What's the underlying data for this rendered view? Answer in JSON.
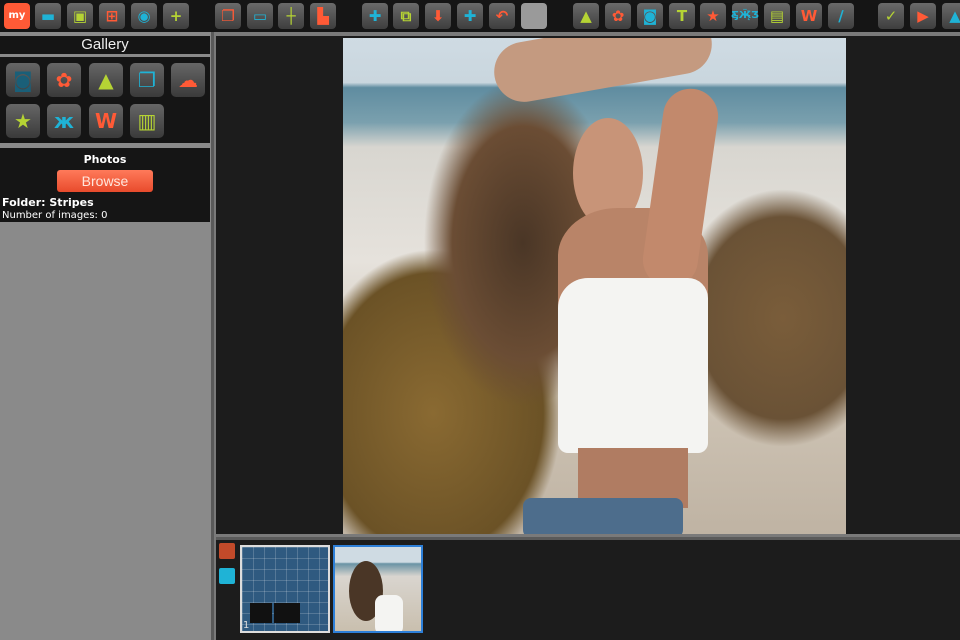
{
  "toolbar": {
    "items": [
      {
        "name": "my-logo",
        "glyph": "my",
        "color": "#ff5a36",
        "bg": "#ff5a36",
        "fg": "#fff"
      },
      {
        "name": "open-folder",
        "glyph": "▬",
        "color": "#1fb3d6"
      },
      {
        "name": "save",
        "glyph": "▣",
        "color": "#b5d334"
      },
      {
        "name": "layout-grid",
        "glyph": "⊞",
        "color": "#ff5a36"
      },
      {
        "name": "download-circle",
        "glyph": "◉",
        "color": "#1fb3d6"
      },
      {
        "name": "new-page",
        "glyph": "+",
        "color": "#b5d334"
      },
      {
        "name": "layers",
        "glyph": "❐",
        "color": "#ff5a36"
      },
      {
        "name": "frame",
        "glyph": "▭",
        "color": "#1fb3d6"
      },
      {
        "name": "crosshair",
        "glyph": "┼",
        "color": "#b5d334"
      },
      {
        "name": "puzzle",
        "glyph": "▙",
        "color": "#ff5a36"
      },
      {
        "name": "gift-box",
        "glyph": "✚",
        "color": "#1fb3d6"
      },
      {
        "name": "shuffle-photos",
        "glyph": "⧉",
        "color": "#b5d334"
      },
      {
        "name": "bag-down",
        "glyph": "⬇",
        "color": "#ff5a36"
      },
      {
        "name": "bag-plus",
        "glyph": "✚",
        "color": "#1fb3d6"
      },
      {
        "name": "undo",
        "glyph": "↶",
        "color": "#ff5a36"
      },
      {
        "name": "blank",
        "glyph": "",
        "color": "#999"
      },
      {
        "name": "image",
        "glyph": "▲",
        "color": "#b5d334"
      },
      {
        "name": "flower",
        "glyph": "✿",
        "color": "#ff5a36"
      },
      {
        "name": "camera",
        "glyph": "◙",
        "color": "#1fb3d6"
      },
      {
        "name": "text",
        "glyph": "T",
        "color": "#b5d334"
      },
      {
        "name": "star-badge",
        "glyph": "★",
        "color": "#ff5a36"
      },
      {
        "name": "butterfly",
        "glyph": "Ƹ̵̡Ӝ̵̨̄Ʒ",
        "color": "#1fb3d6"
      },
      {
        "name": "ticket",
        "glyph": "▤",
        "color": "#b5d334"
      },
      {
        "name": "word-art",
        "glyph": "W",
        "color": "#ff5a36"
      },
      {
        "name": "brush",
        "glyph": "∕",
        "color": "#1fb3d6"
      },
      {
        "name": "check",
        "glyph": "✓",
        "color": "#b5d334"
      },
      {
        "name": "play",
        "glyph": "▶",
        "color": "#ff5a36"
      },
      {
        "name": "share",
        "glyph": "▲",
        "color": "#1fb3d6"
      }
    ]
  },
  "gallery": {
    "title": "Gallery",
    "items": [
      {
        "name": "camera",
        "glyph": "◙",
        "color": "#1a5f78"
      },
      {
        "name": "flower",
        "glyph": "✿",
        "color": "#ff5a36"
      },
      {
        "name": "image",
        "glyph": "▲",
        "color": "#b5d334"
      },
      {
        "name": "layers",
        "glyph": "❐",
        "color": "#1fb3d6"
      },
      {
        "name": "cloud",
        "glyph": "☁",
        "color": "#ff5a36"
      },
      {
        "name": "star-badge",
        "glyph": "★",
        "color": "#b5d334"
      },
      {
        "name": "butterfly",
        "glyph": "ж",
        "color": "#1fb3d6"
      },
      {
        "name": "word-art",
        "glyph": "W",
        "color": "#ff5a36"
      },
      {
        "name": "layout",
        "glyph": "▥",
        "color": "#b5d334"
      }
    ]
  },
  "photos": {
    "heading": "Photos",
    "browse_label": "Browse",
    "folder": "Folder: Stripes",
    "count": "Number of images: 0"
  },
  "pages": {
    "page_number": "1"
  }
}
